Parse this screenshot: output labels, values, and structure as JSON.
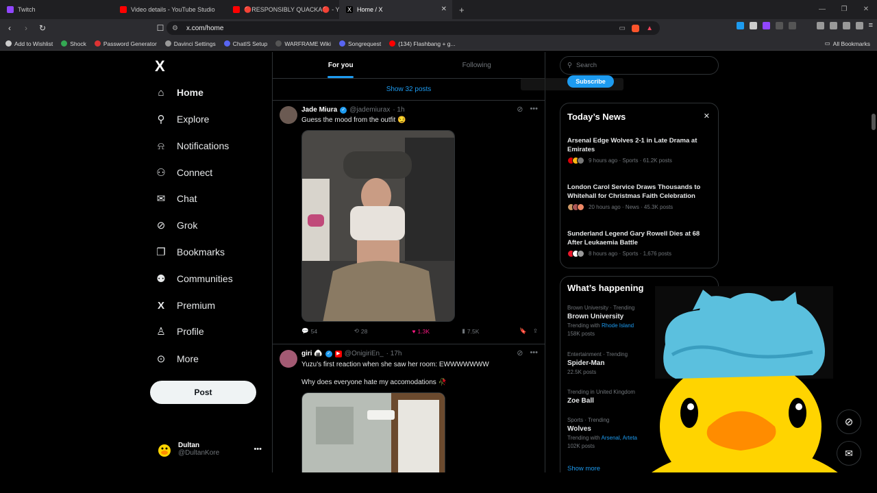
{
  "browser": {
    "tabs": [
      {
        "title": "Twitch",
        "color": "#9146ff"
      },
      {
        "title": "Video details - YouTube Studio",
        "color": "#ff0000"
      },
      {
        "title": "🔴RESPONSIBLY QUACKA🔴 - YouT",
        "color": "#ff0000"
      },
      {
        "title": "Home / X",
        "color": "#ffffff"
      }
    ],
    "url": "x.com/home",
    "bookmarks": [
      "Add to Wishlist",
      "Shock",
      "Password Generator",
      "Davinci Settings",
      "ChatIS Setup",
      "WARFRAME Wiki",
      "Songrequest",
      "(134) Flashbang + g..."
    ],
    "all_bookmarks": "All Bookmarks"
  },
  "nav": {
    "logo": "X",
    "items": [
      {
        "label": "Home",
        "icon": "home-icon",
        "glyph": "⌂"
      },
      {
        "label": "Explore",
        "icon": "search-icon",
        "glyph": "⚲"
      },
      {
        "label": "Notifications",
        "icon": "bell-icon",
        "glyph": "⍾"
      },
      {
        "label": "Connect",
        "icon": "add-person-icon",
        "glyph": "⚇"
      },
      {
        "label": "Chat",
        "icon": "mail-icon",
        "glyph": "✉"
      },
      {
        "label": "Grok",
        "icon": "grok-icon",
        "glyph": "⊘"
      },
      {
        "label": "Bookmarks",
        "icon": "bookmark-icon",
        "glyph": "❐"
      },
      {
        "label": "Communities",
        "icon": "communities-icon",
        "glyph": "⚉"
      },
      {
        "label": "Premium",
        "icon": "x-icon",
        "glyph": "X"
      },
      {
        "label": "Profile",
        "icon": "profile-icon",
        "glyph": "♙"
      },
      {
        "label": "More",
        "icon": "more-circle-icon",
        "glyph": "⊙"
      }
    ],
    "post_label": "Post",
    "account": {
      "name": "Dultan",
      "handle": "@DultanKore"
    }
  },
  "feed": {
    "tabs": [
      "For you",
      "Following"
    ],
    "show_posts": "Show 32 posts",
    "tweets": [
      {
        "name": "Jade Miura",
        "handle": "@jademiurax",
        "time": "· 1h",
        "text": "Guess the mood from the outfit 😏",
        "replies": "54",
        "reposts": "28",
        "likes": "1.3K",
        "views": "7.5K"
      },
      {
        "name": "giri 🍙",
        "handle": "@OnigiriEn_",
        "time": "· 17h",
        "text": "Yuzu's first reaction when she saw her room: EWWWWWWW",
        "text2": "Why does everyone hate my accomodations 🥀"
      }
    ]
  },
  "right": {
    "search_placeholder": "Search",
    "subscribe": "Subscribe",
    "news_title": "Today’s News",
    "news": [
      {
        "title": "Arsenal Edge Wolves 2-1 in Late Drama at Emirates",
        "meta": "9 hours ago · Sports · 61.2K posts"
      },
      {
        "title": "London Carol Service Draws Thousands to Whitehall for Christmas Faith Celebration",
        "meta": "20 hours ago · News · 45.3K posts"
      },
      {
        "title": "Sunderland Legend Gary Rowell Dies at 68 After Leukaemia Battle",
        "meta": "8 hours ago · Sports · 1,676 posts"
      }
    ],
    "happening_title": "What’s happening",
    "trends": [
      {
        "context": "Brown University · Trending",
        "name": "Brown University",
        "with_label": "Trending with",
        "with": "Rhode Island",
        "posts": "158K posts"
      },
      {
        "context": "Entertainment · Trending",
        "name": "Spider-Man",
        "posts": "22.5K posts"
      },
      {
        "context": "Trending in United Kingdom",
        "name": "Zoe Ball"
      },
      {
        "context": "Sports · Trending",
        "name": "Wolves",
        "with_label": "Trending with",
        "with": "Arsenal, Arteta",
        "posts": "102K posts"
      }
    ],
    "show_more": "Show more"
  },
  "colors": {
    "accent": "#1d9bf0",
    "like": "#f91880",
    "duck": "#ffd400",
    "hat": "#5bc0de"
  }
}
